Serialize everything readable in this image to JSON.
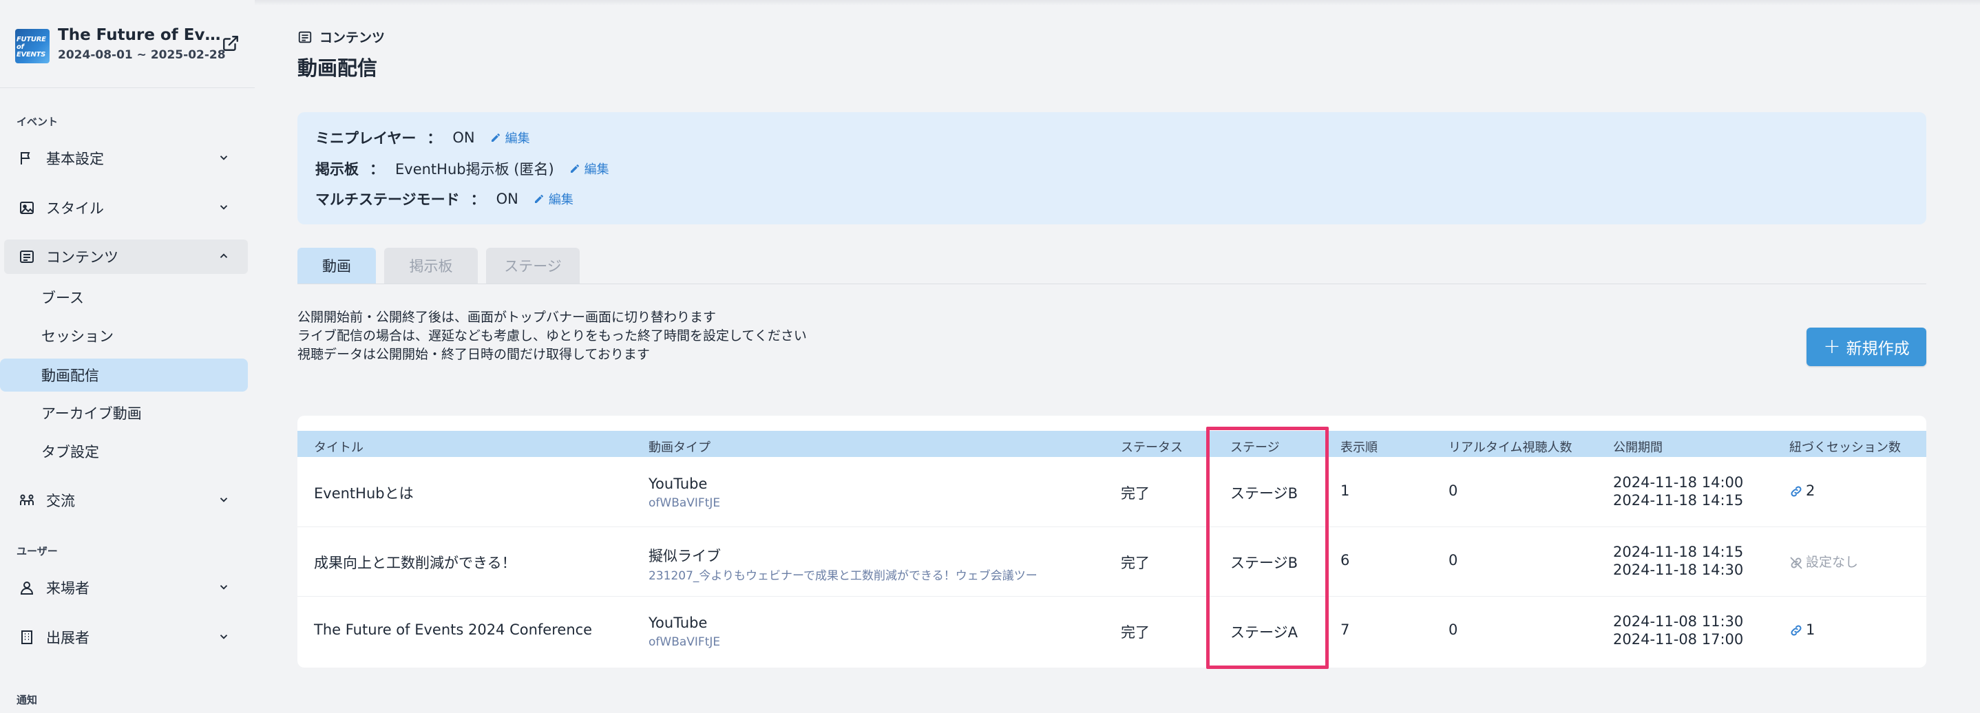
{
  "event": {
    "logo_text": "FUTURE of EVENTS",
    "title": "The Future of Events",
    "dates": "2024-08-01 ~ 2025-02-28"
  },
  "sidebar": {
    "section_event": "イベント",
    "section_user": "ユーザー",
    "section_notify": "通知",
    "items": {
      "basic": "基本設定",
      "style": "スタイル",
      "contents": "コンテンツ",
      "exchange": "交流",
      "visitors": "来場者",
      "exhibitors": "出展者"
    },
    "sub_items": [
      "ブース",
      "セッション",
      "動画配信",
      "アーカイブ動画",
      "タブ設定"
    ]
  },
  "breadcrumb": "コンテンツ",
  "page_title": "動画配信",
  "info": {
    "rows": [
      {
        "key": "ミニプレイヤー",
        "sep": "：",
        "value": "ON",
        "edit": "編集"
      },
      {
        "key": "掲示板",
        "sep": "：",
        "value": "EventHub掲示板 (匿名)",
        "edit": "編集"
      },
      {
        "key": "マルチステージモード",
        "sep": "：",
        "value": "ON",
        "edit": "編集"
      }
    ]
  },
  "tabs": [
    "動画",
    "掲示板",
    "ステージ"
  ],
  "notes": [
    "公開開始前・公開終了後は、画面がトップバナー画面に切り替わります",
    "ライブ配信の場合は、遅延なども考慮し、ゆとりをもった終了時間を設定してください",
    "視聴データは公開開始・終了日時の間だけ取得しております"
  ],
  "new_button": "新規作成",
  "table": {
    "headers": [
      "タイトル",
      "動画タイプ",
      "ステータス",
      "ステージ",
      "表示順",
      "リアルタイム視聴人数",
      "公開期間",
      "紐づくセッション数"
    ],
    "rows": [
      {
        "title": "EventHubとは",
        "type": "YouTube",
        "type_sub": "ofWBaVIFtJE",
        "status": "完了",
        "stage": "ステージB",
        "order": "1",
        "viewers": "0",
        "start": "2024-11-18 14:00",
        "end": "2024-11-18 14:15",
        "sessions": "2"
      },
      {
        "title": "成果向上と工数削減ができる！",
        "type": "擬似ライブ",
        "type_sub": "231207_今よりもウェビナーで成果と工数削減ができる！ウェブ会議ツー",
        "status": "完了",
        "stage": "ステージB",
        "order": "6",
        "viewers": "0",
        "start": "2024-11-18 14:15",
        "end": "2024-11-18 14:30",
        "sessions": "設定なし"
      },
      {
        "title": "The Future of Events 2024 Conference",
        "type": "YouTube",
        "type_sub": "ofWBaVIFtJE",
        "status": "完了",
        "stage": "ステージA",
        "order": "7",
        "viewers": "0",
        "start": "2024-11-08 11:30",
        "end": "2024-11-08 17:00",
        "sessions": "1"
      }
    ]
  },
  "colors": {
    "accent": "#3d97da",
    "highlight": "#e8336d",
    "header_bg": "#c0def6",
    "info_bg": "#e1eefb"
  }
}
